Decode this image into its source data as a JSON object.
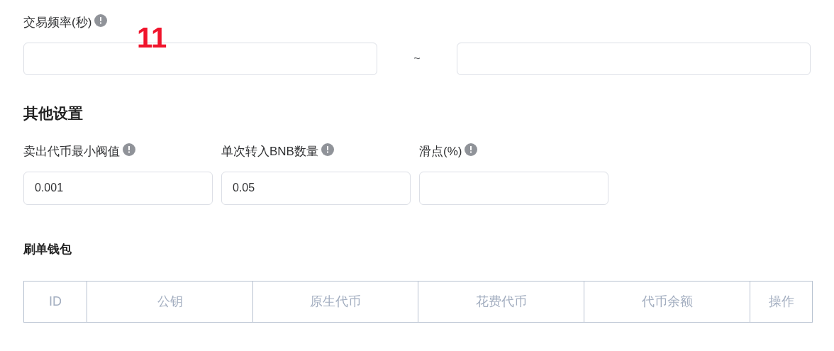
{
  "annotation": {
    "text": "11"
  },
  "frequency": {
    "label": "交易频率(秒)",
    "separator": "~"
  },
  "other_settings": {
    "title": "其他设置",
    "fields": [
      {
        "label": "卖出代币最小阀值",
        "value": "0.001"
      },
      {
        "label": "单次转入BNB数量",
        "value": "0.05"
      },
      {
        "label": "滑点(%)"
      }
    ]
  },
  "wallets": {
    "title": "刷单钱包",
    "table": {
      "columns": [
        "ID",
        "公钥",
        "原生代币",
        "花费代币",
        "代币余额",
        "操作"
      ]
    }
  }
}
